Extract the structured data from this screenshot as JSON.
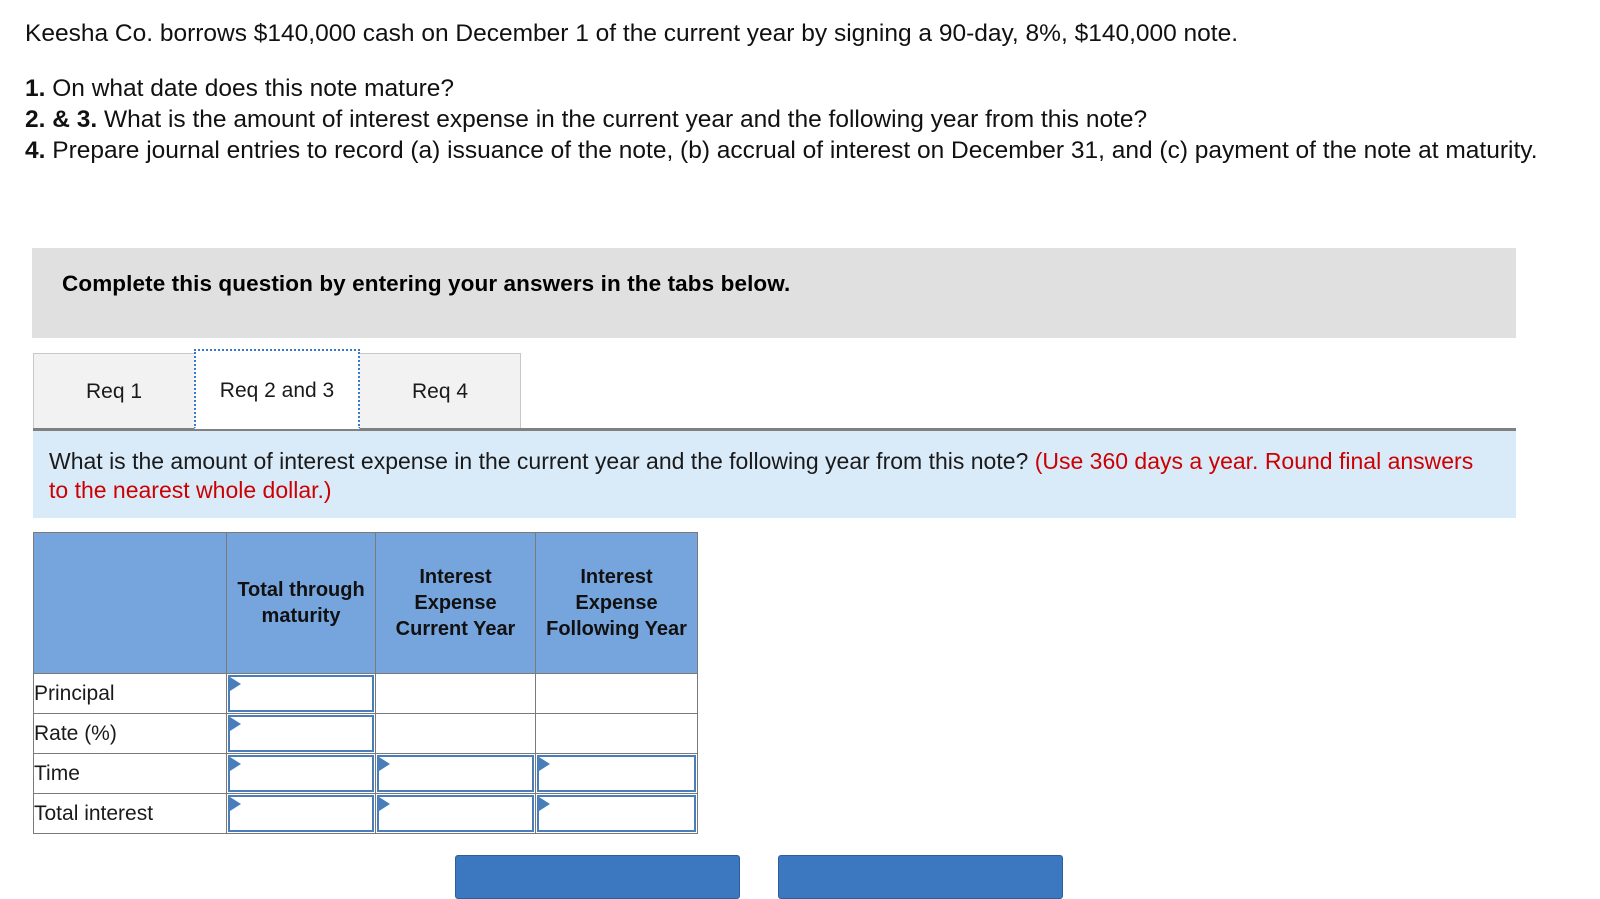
{
  "prompt": {
    "lead": "Keesha Co. borrows $140,000 cash on December 1 of the current year by signing a 90-day, 8%, $140,000 note.",
    "req1_num": "1.",
    "req1_text": " On what date does this note mature?",
    "req23_num": "2. & 3.",
    "req23_text": " What is the amount of interest expense in the current year and the following year from this note?",
    "req4_num": "4.",
    "req4_text": " Prepare journal entries to record (a) issuance of the note, (b) accrual of interest on December 31, and (c) payment of the note at maturity."
  },
  "banner": {
    "text": "Complete this question by entering your answers in the tabs below."
  },
  "tabs": [
    {
      "label": "Req 1",
      "active": false
    },
    {
      "label": "Req 2 and 3",
      "active": true
    },
    {
      "label": "Req 4",
      "active": false
    }
  ],
  "requirement": {
    "question": "What is the amount of interest expense in the current year and the following year from this note?",
    "hint": "(Use 360 days a year. Round final answers to the nearest whole dollar.)"
  },
  "table": {
    "headers": [
      "",
      "Total through maturity",
      "Interest Expense Current Year",
      "Interest Expense Following Year"
    ],
    "rows": [
      {
        "label": "Principal",
        "cells": [
          "input",
          "empty",
          "empty"
        ]
      },
      {
        "label": "Rate (%)",
        "cells": [
          "input",
          "empty",
          "empty"
        ]
      },
      {
        "label": "Time",
        "cells": [
          "input",
          "input",
          "input"
        ]
      },
      {
        "label": "Total interest",
        "cells": [
          "input",
          "input",
          "input"
        ]
      }
    ],
    "values": {
      "principal": "",
      "rate": "",
      "time": "",
      "total_interest": ""
    }
  },
  "footer": {
    "prev_label": "",
    "next_label": ""
  },
  "colors": {
    "header_blue": "#76a5de",
    "panel_blue": "#d9ebf9",
    "banner_gray": "#e0e0e0",
    "hint_red": "#cc0000",
    "entry_border": "#4a7ebb",
    "button_blue": "#3c78c0",
    "tab_focus": "#3c78c8"
  }
}
